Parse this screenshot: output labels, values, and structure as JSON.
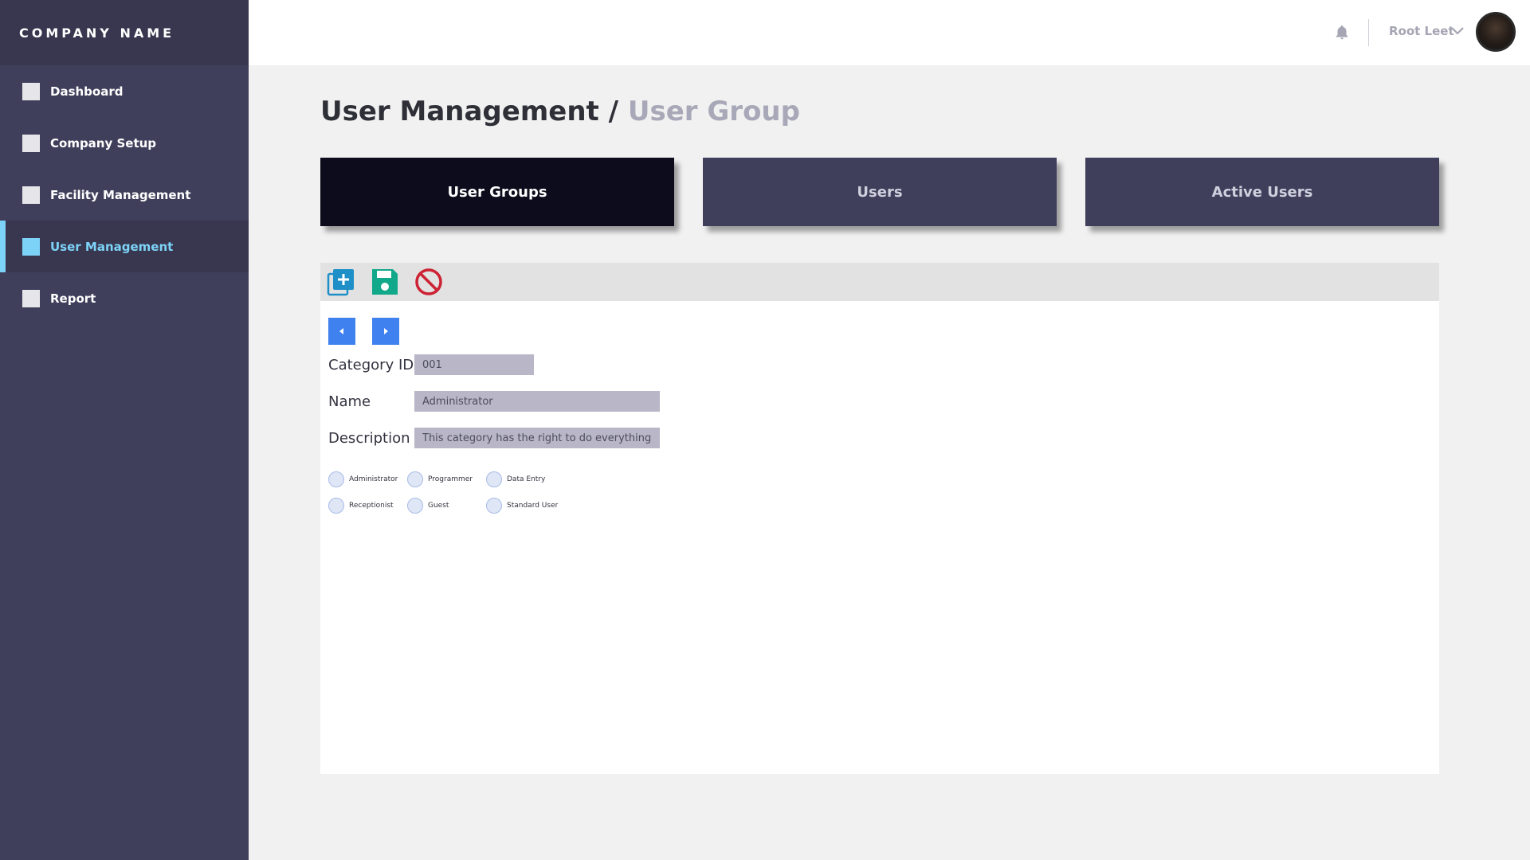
{
  "brand": {
    "name": "COMPANY NAME"
  },
  "sidebar": {
    "items": [
      {
        "label": "Dashboard",
        "active": false
      },
      {
        "label": "Company Setup",
        "active": false
      },
      {
        "label": "Facility Management",
        "active": false
      },
      {
        "label": "User Management",
        "active": true
      },
      {
        "label": "Report",
        "active": false
      }
    ]
  },
  "topbar": {
    "user_name": "Root Leet",
    "icons": [
      "bell-icon",
      "chevron-down-icon",
      "avatar"
    ]
  },
  "breadcrumb": {
    "section": "User Management",
    "separator": "/",
    "page": "User Group"
  },
  "tabs": [
    {
      "label": "User Groups",
      "active": true
    },
    {
      "label": "Users",
      "active": false
    },
    {
      "label": "Active Users",
      "active": false
    }
  ],
  "toolbar": {
    "icons": [
      "add-icon",
      "save-icon",
      "cancel-icon"
    ]
  },
  "pager": {
    "icons": [
      "previous-icon",
      "next-icon"
    ]
  },
  "form": {
    "category_id": {
      "label": "Category ID",
      "value": "001"
    },
    "name": {
      "label": "Name",
      "value": "Administrator"
    },
    "description": {
      "label": "Description",
      "value": "This category has the right to do everything"
    }
  },
  "roles": [
    {
      "label": "Administrator",
      "selected": false
    },
    {
      "label": "Programmer",
      "selected": false
    },
    {
      "label": "Data Entry",
      "selected": false
    },
    {
      "label": "Receptionist",
      "selected": false
    },
    {
      "label": "Guest",
      "selected": false
    },
    {
      "label": "Standard User",
      "selected": false
    }
  ],
  "colors": {
    "sidebar_bg": "#403f5b",
    "sidebar_header_bg": "#38374f",
    "active_accent": "#7dd3f7",
    "tab_active_bg": "#0c0c1c",
    "tab_bg": "#403f5b",
    "add_icon": "#1e8fc7",
    "save_icon": "#12a88a",
    "cancel_icon": "#cc2233",
    "pager_button": "#3f82ef",
    "input_bg": "#b9b7c7"
  }
}
